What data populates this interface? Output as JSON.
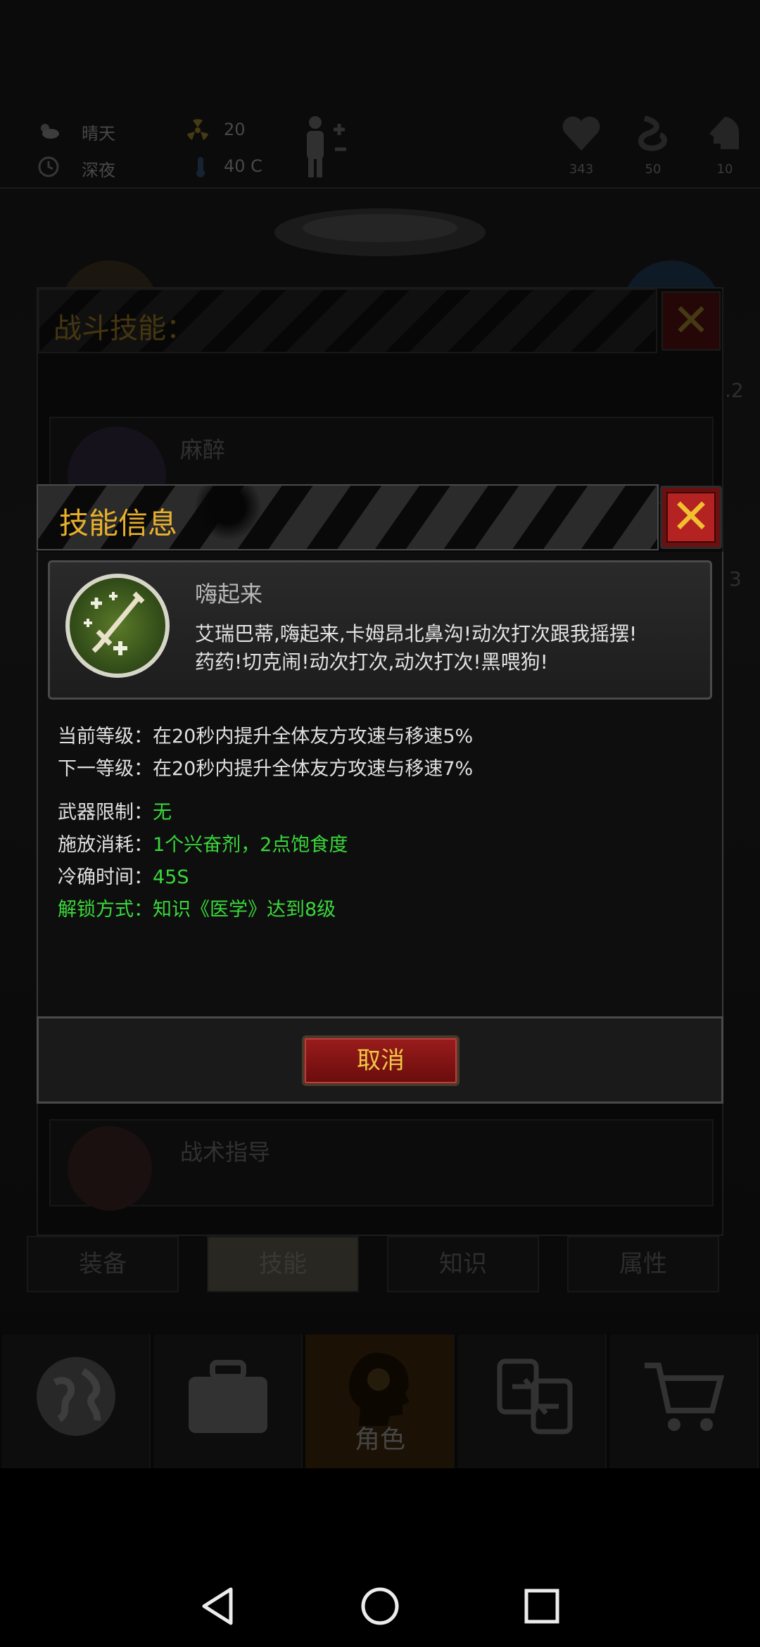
{
  "status": {
    "weather": "晴天",
    "time_of_day": "深夜",
    "radiation": "20",
    "temperature": "40 C",
    "health": "343",
    "stamina": "50",
    "mood": "10"
  },
  "background": {
    "combat_title": "战斗技能：",
    "rows": [
      "麻醉",
      "战术指导"
    ],
    "side_numbers": [
      ".2",
      "3"
    ]
  },
  "tabs": [
    {
      "label": "装备"
    },
    {
      "label": "技能"
    },
    {
      "label": "知识"
    },
    {
      "label": "属性"
    }
  ],
  "nav": {
    "role_label": "角色"
  },
  "dialog": {
    "title": "技能信息",
    "skill_name": "嗨起来",
    "skill_desc_1": "艾瑞巴蒂,嗨起来,卡姆昂北鼻沟!动次打次跟我摇摆!",
    "skill_desc_2": "药药!切克闹!动次打次,动次打次!黑喂狗!",
    "current_level_label": "当前等级：",
    "current_level_value": "在20秒内提升全体友方攻速与移速5%",
    "next_level_label": "下一等级：",
    "next_level_value": "在20秒内提升全体友方攻速与移速7%",
    "weapon_label": "武器限制：",
    "weapon_value": "无",
    "cost_label": "施放消耗：",
    "cost_value": "1个兴奋剂，2点饱食度",
    "cooldown_label": "冷确时间：",
    "cooldown_value": "45S",
    "unlock_text": "解锁方式：知识《医学》达到8级",
    "cancel_label": "取消"
  },
  "colors": {
    "accent_gold": "#e8b02c",
    "value_green": "#39d83a",
    "close_red": "#b42222"
  }
}
